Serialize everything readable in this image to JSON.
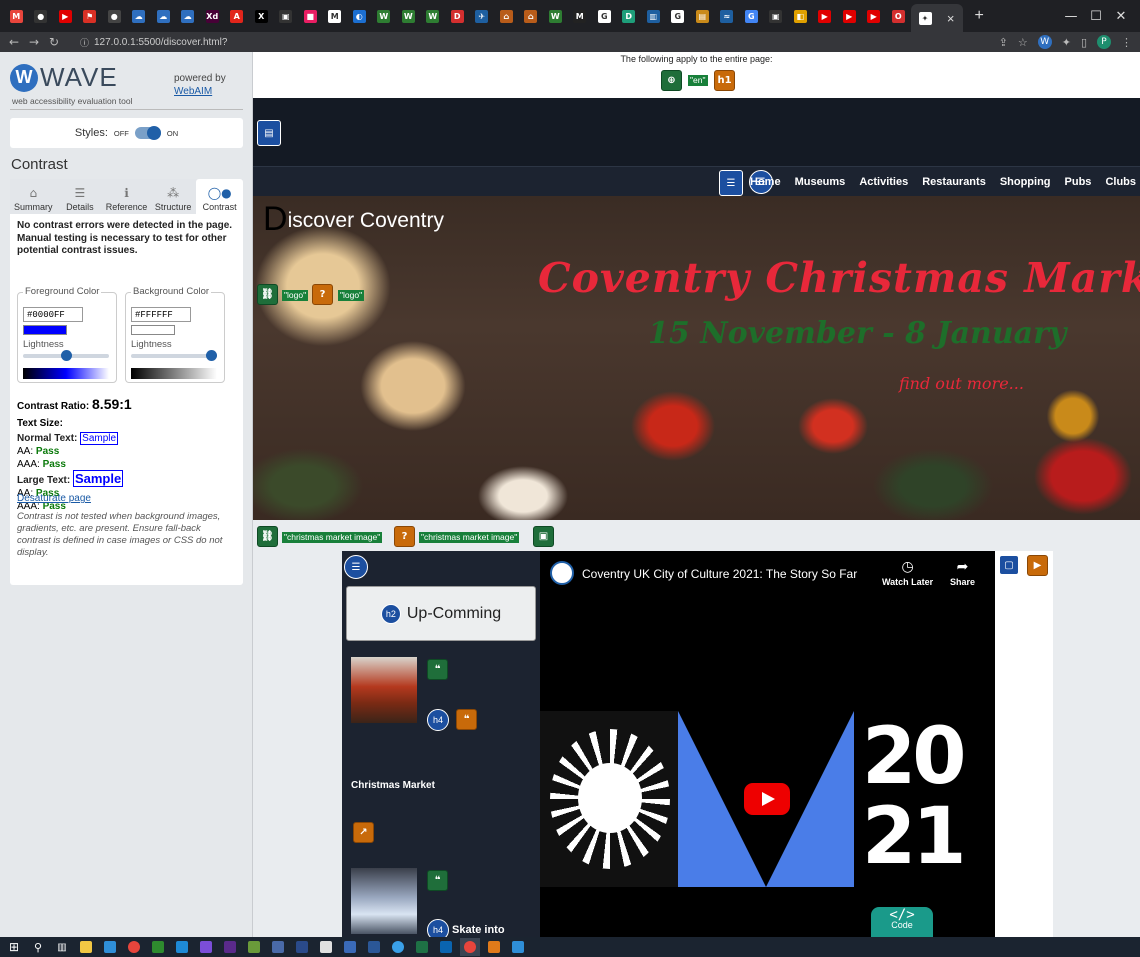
{
  "browser": {
    "tabs": [
      {
        "icon": "gmail-icon",
        "color": "#e8453c",
        "glyph": "M"
      },
      {
        "icon": "github-icon",
        "color": "#333333",
        "glyph": "●"
      },
      {
        "icon": "youtube-icon",
        "color": "#e00000",
        "glyph": "▶"
      },
      {
        "icon": "pdf-icon",
        "color": "#d93025",
        "glyph": "⚑"
      },
      {
        "icon": "github-icon",
        "color": "#444444",
        "glyph": "●"
      },
      {
        "icon": "azure-icon",
        "color": "#2f6fbf",
        "glyph": "☁"
      },
      {
        "icon": "azure-icon",
        "color": "#2f6fbf",
        "glyph": "☁"
      },
      {
        "icon": "azure-icon",
        "color": "#2f6fbf",
        "glyph": "☁"
      },
      {
        "icon": "xd-icon",
        "color": "#470137",
        "glyph": "Xd"
      },
      {
        "icon": "adobe-icon",
        "color": "#e1251b",
        "glyph": "A"
      },
      {
        "icon": "x-icon",
        "color": "#000000",
        "glyph": "X"
      },
      {
        "icon": "bag-icon",
        "color": "#333333",
        "glyph": "▣"
      },
      {
        "icon": "app-icon",
        "color": "#e91e63",
        "glyph": "■"
      },
      {
        "icon": "gmail-icon",
        "color": "#ffffff",
        "glyph": "M"
      },
      {
        "icon": "edge-icon",
        "color": "#1c6fd1",
        "glyph": "◐"
      },
      {
        "icon": "webflow-icon",
        "color": "#2e7d32",
        "glyph": "W"
      },
      {
        "icon": "webflow-icon",
        "color": "#2e7d32",
        "glyph": "W"
      },
      {
        "icon": "webflow-icon",
        "color": "#2e7d32",
        "glyph": "W"
      },
      {
        "icon": "d-icon",
        "color": "#d32f2f",
        "glyph": "D"
      },
      {
        "icon": "bird-icon",
        "color": "#1e5fa0",
        "glyph": "✈"
      },
      {
        "icon": "ladder-icon",
        "color": "#b85c1a",
        "glyph": "⌂"
      },
      {
        "icon": "ladder-icon",
        "color": "#b85c1a",
        "glyph": "⌂"
      },
      {
        "icon": "webflow-icon",
        "color": "#2e7d32",
        "glyph": "W"
      },
      {
        "icon": "m-icon",
        "color": "#222222",
        "glyph": "M"
      },
      {
        "icon": "google-icon",
        "color": "#ffffff",
        "glyph": "G"
      },
      {
        "icon": "d-icon",
        "color": "#1e9e7a",
        "glyph": "D"
      },
      {
        "icon": "chart-icon",
        "color": "#1e5fa0",
        "glyph": "▥"
      },
      {
        "icon": "google-icon",
        "color": "#ffffff",
        "glyph": "G"
      },
      {
        "icon": "books-icon",
        "color": "#c98a1a",
        "glyph": "▤"
      },
      {
        "icon": "wave-icon",
        "color": "#1e5fa0",
        "glyph": "≈"
      },
      {
        "icon": "google-icon",
        "color": "#4285f4",
        "glyph": "G"
      },
      {
        "icon": "bag-icon",
        "color": "#333333",
        "glyph": "▣"
      },
      {
        "icon": "flag-icon",
        "color": "#e0a000",
        "glyph": "◧"
      },
      {
        "icon": "youtube-icon",
        "color": "#e00000",
        "glyph": "▶"
      },
      {
        "icon": "youtube-icon",
        "color": "#e00000",
        "glyph": "▶"
      },
      {
        "icon": "youtube-icon",
        "color": "#e00000",
        "glyph": "▶"
      },
      {
        "icon": "opera-icon",
        "color": "#d32f2f",
        "glyph": "O"
      }
    ],
    "active_tab_close": "×",
    "new_tab": "+",
    "window": {
      "minimize": "—",
      "maximize": "☐",
      "close": "✕"
    },
    "url": "127.0.0.1:5500/discover.html?",
    "profile": "P"
  },
  "wave": {
    "logo_letter": "W",
    "logo_text": "WAVE",
    "tagline": "web accessibility evaluation tool",
    "powered_by": "powered by",
    "webaim": "WebAIM",
    "styles_label": "Styles:",
    "off": "OFF",
    "on": "ON",
    "panel_title": "Contrast",
    "tabs": [
      {
        "label": "Summary",
        "icon": "home-icon",
        "glyph": "⌂"
      },
      {
        "label": "Details",
        "icon": "list-icon",
        "glyph": "☰"
      },
      {
        "label": "Reference",
        "icon": "info-icon",
        "glyph": "ℹ"
      },
      {
        "label": "Structure",
        "icon": "structure-icon",
        "glyph": "⁂"
      },
      {
        "label": "Contrast",
        "icon": "contrast-icon",
        "glyph": "◯●"
      }
    ],
    "summary": "No contrast errors were detected in the page. Manual testing is necessary to test for other potential contrast issues.",
    "fg_label": "Foreground Color",
    "fg_hex": "#0000FF",
    "fg_swatch": "#0000ff",
    "bg_label": "Background Color",
    "bg_hex": "#FFFFFF",
    "bg_swatch": "#ffffff",
    "lightness": "Lightness",
    "fg_lightness": 0.5,
    "bg_lightness": 1.0,
    "ratio_label": "Contrast Ratio:",
    "ratio_value": "8.59:1",
    "text_size": "Text Size:",
    "normal_text": "Normal Text:",
    "large_text": "Large Text:",
    "sample": "Sample",
    "aa": "AA:",
    "aaa": "AAA:",
    "pass": "Pass",
    "desaturate": "Desaturate page",
    "note": "Contrast is not tested when background images, gradients, etc. are present. Ensure fall-back contrast is defined in case images or CSS do not display."
  },
  "site": {
    "entire_page": "The following apply to the entire page:",
    "lang_label": "\"en\"",
    "h1_badge": "h1",
    "nav": [
      "Home",
      "Museums",
      "Activities",
      "Restaurants",
      "Shopping",
      "Pubs",
      "Clubs"
    ],
    "hero_first_letter": "D",
    "hero_title_rest": "iscover Coventry",
    "logo_label_1": "\"logo\"",
    "logo_label_2": "\"logo\"",
    "hero_heading": "Coventry Christmas Market",
    "hero_dates": "15 November - 8 January",
    "hero_more": "find out more...",
    "img_label_1": "\"christmas market image\"",
    "img_label_2": "\"christmas market image\"",
    "upcoming_badge": "h2",
    "upcoming": "Up-Comming",
    "h4_badge": "h4",
    "christmas_market": "Christmas Market",
    "skate": "Skate into",
    "video_title": "Coventry UK City of Culture 2021: The Story So Far",
    "watch_later": "Watch Later",
    "share": "Share",
    "art_number": "20\n21",
    "code_glyph": "</>",
    "code_label": "Code"
  }
}
